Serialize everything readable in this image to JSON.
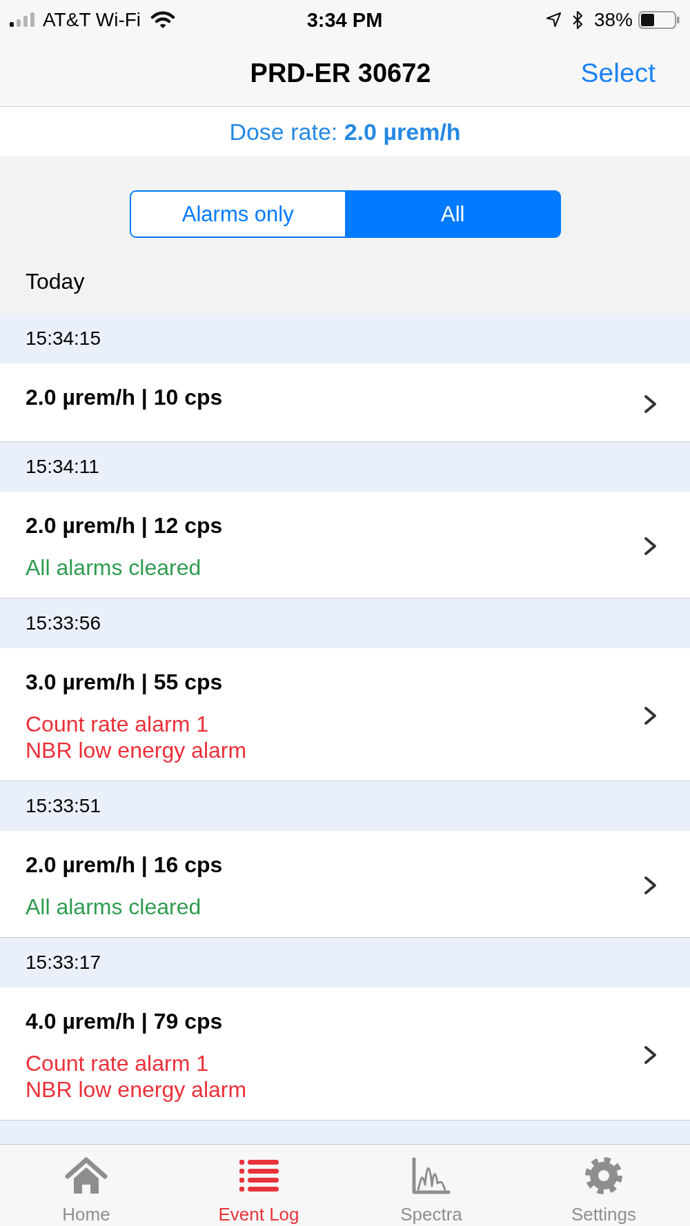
{
  "status_bar": {
    "carrier": "AT&T Wi-Fi",
    "time": "3:34 PM",
    "battery": "38%"
  },
  "nav_bar": {
    "title": "PRD-ER 30672",
    "action": "Select"
  },
  "dose_rate": "Dose rate: **2.0 µrem/h**",
  "filter": {
    "segments": [
      {
        "label": "Alarms only",
        "selected": false
      },
      {
        "label": "All",
        "selected": true
      }
    ]
  },
  "section_title": "Today",
  "events": [
    {
      "time": "15:34:15",
      "reading": "2.0 µrem/h | 10 cps"
    },
    {
      "time": "15:34:11",
      "reading": "2.0 µrem/h | 12 cps",
      "messages": [
        {
          "text": "All alarms cleared",
          "kind": "cleared"
        }
      ]
    },
    {
      "time": "15:33:56",
      "reading": "3.0 µrem/h | 55 cps",
      "messages": [
        {
          "text": "Count rate alarm 1",
          "kind": "alarm"
        },
        {
          "text": "NBR low energy alarm",
          "kind": "alarm"
        }
      ]
    },
    {
      "time": "15:33:51",
      "reading": "2.0 µrem/h | 16 cps",
      "messages": [
        {
          "text": "All alarms cleared",
          "kind": "cleared"
        }
      ]
    },
    {
      "time": "15:33:17",
      "reading": "4.0 µrem/h | 79 cps",
      "messages": [
        {
          "text": "Count rate alarm 1",
          "kind": "alarm"
        },
        {
          "text": "NBR low energy alarm",
          "kind": "alarm"
        }
      ]
    }
  ],
  "tab_bar": {
    "tabs": [
      {
        "label": "Home",
        "selected": false
      },
      {
        "label": "Event Log",
        "selected": true
      },
      {
        "label": "Spectra",
        "selected": false
      },
      {
        "label": "Settings",
        "selected": false
      }
    ]
  }
}
